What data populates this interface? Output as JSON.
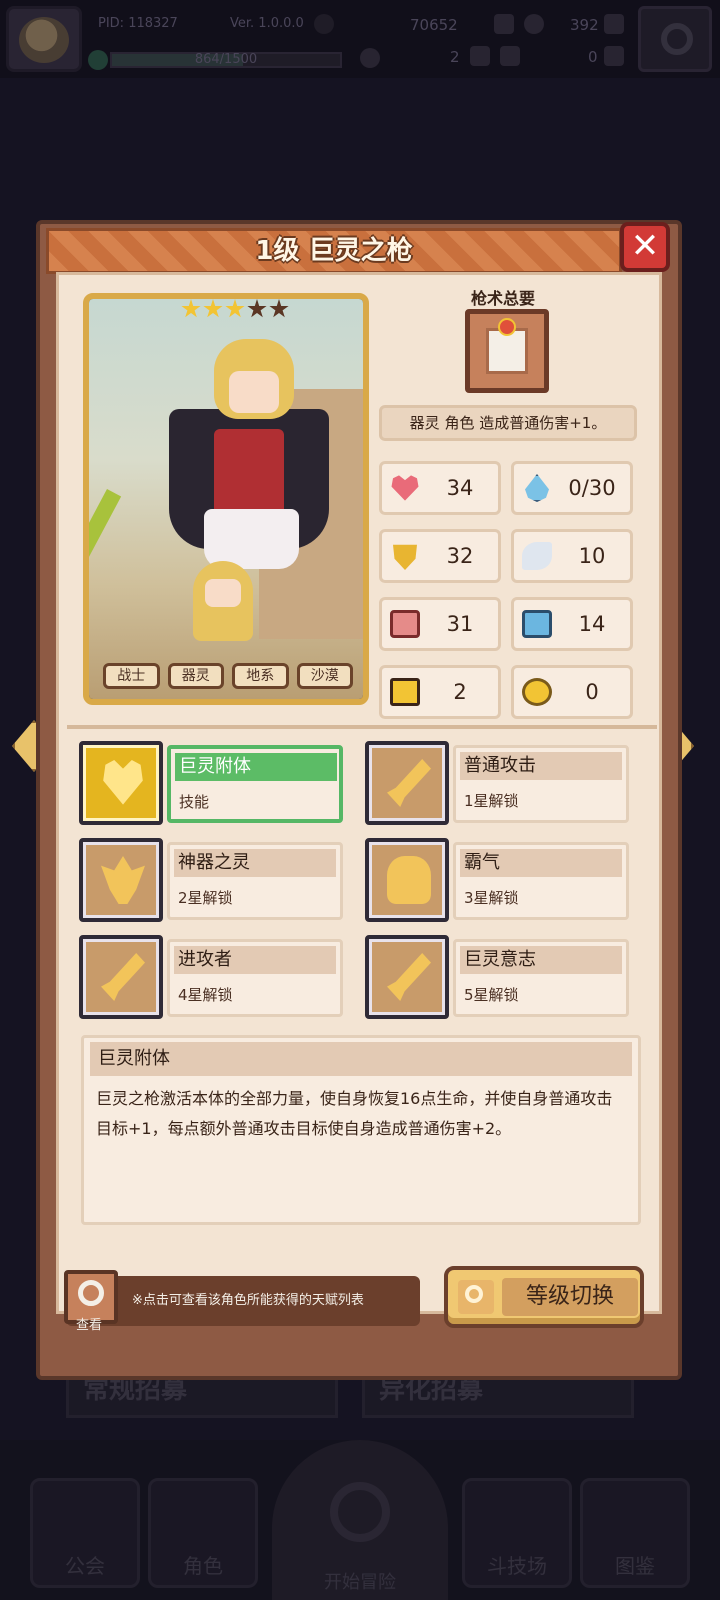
{
  "background": {
    "pid": "PID: 118327",
    "version": "Ver. 1.0.0.0",
    "xp_text": "864/1500",
    "xp_progress": 0.576,
    "res_coins": "70652",
    "res_gems": "392",
    "res_clover": "2",
    "res_keys": "0",
    "banner_left": "常规招募",
    "banner_right": "异化招募",
    "nav": [
      "公会",
      "角色",
      "开始冒险",
      "斗技场",
      "图鉴"
    ]
  },
  "modal": {
    "title": "1级 巨灵之枪",
    "close_label": "✕",
    "stars": {
      "filled": 3,
      "total": 5
    },
    "tags": [
      "战士",
      "器灵",
      "地系",
      "沙漠"
    ],
    "skill_book_label": "枪术总要",
    "effect_desc": "器灵 角色 造成普通伤害+1。",
    "stats": [
      {
        "icon": "heart-icon",
        "value": "34"
      },
      {
        "icon": "water-drop-icon",
        "value": "0/30"
      },
      {
        "icon": "shield-icon",
        "value": "32"
      },
      {
        "icon": "wing-icon",
        "value": "10"
      },
      {
        "icon": "fist-icon",
        "value": "31"
      },
      {
        "icon": "spellbook-icon",
        "value": "14"
      },
      {
        "icon": "card-icon",
        "value": "2"
      },
      {
        "icon": "clock-icon",
        "value": "0"
      }
    ],
    "talents": [
      {
        "name": "巨灵附体",
        "sub": "技能",
        "icon": "heart-emblem-icon",
        "selected": true
      },
      {
        "name": "普通攻击",
        "sub": "1星解锁",
        "icon": "sword-icon",
        "selected": false
      },
      {
        "name": "神器之灵",
        "sub": "2星解锁",
        "icon": "crown-icon",
        "selected": false
      },
      {
        "name": "霸气",
        "sub": "3星解锁",
        "icon": "helmet-icon",
        "selected": false
      },
      {
        "name": "进攻者",
        "sub": "4星解锁",
        "icon": "sword-icon",
        "selected": false
      },
      {
        "name": "巨灵意志",
        "sub": "5星解锁",
        "icon": "sword-icon",
        "selected": false
      }
    ],
    "detail": {
      "title": "巨灵附体",
      "text": "巨灵之枪激活本体的全部力量，使自身恢复16点生命，并使自身普通攻击目标+1，每点额外普通攻击目标使自身造成普通伤害+2。"
    },
    "hint": {
      "icon_label": "查看",
      "text": "※点击可查看该角色所能获得的天赋列表"
    },
    "level_switch_label": "等级切换"
  },
  "colors": {
    "modal_frame": "#8e5a44",
    "panel": "#f3e4d3",
    "selected_green": "#5cbc66",
    "gold": "#f2c434",
    "close_red": "#d23a36"
  }
}
